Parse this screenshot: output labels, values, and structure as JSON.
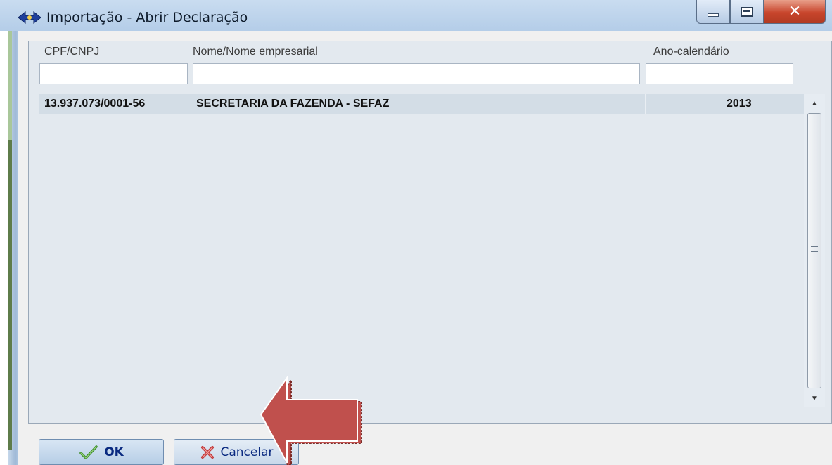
{
  "window": {
    "title": "Importação - Abrir Declaração",
    "icon": "app-diamond-arrow-icon",
    "controls": [
      "minimize-icon",
      "maximize-icon",
      "close-icon"
    ]
  },
  "table": {
    "columns": [
      {
        "label": "CPF/CNPJ"
      },
      {
        "label": "Nome/Nome empresarial"
      },
      {
        "label": "Ano-calendário"
      }
    ],
    "filters": [
      {
        "value": "",
        "placeholder": ""
      },
      {
        "value": "",
        "placeholder": ""
      },
      {
        "value": "",
        "placeholder": ""
      }
    ],
    "rows": [
      {
        "cpf_cnpj": "13.937.073/0001-56",
        "nome": "SECRETARIA DA FAZENDA - SEFAZ",
        "ano": "2013"
      }
    ]
  },
  "buttons": {
    "ok": {
      "label": "OK",
      "icon": "checkmark-icon"
    },
    "cancel": {
      "label": "Cancelar",
      "icon": "x-mark-icon"
    }
  },
  "annotation": {
    "icon": "red-arrow-pointer-icon"
  },
  "colors": {
    "title_bar": "#b4cde8",
    "close_button": "#c8452c",
    "selected_row": "#d3dde6",
    "annotation_arrow": "#c0504d"
  }
}
